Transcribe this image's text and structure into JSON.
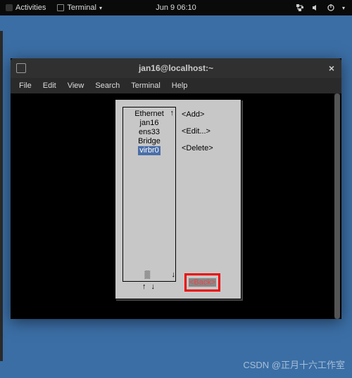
{
  "topbar": {
    "activities": "Activities",
    "terminal": "Terminal",
    "datetime": "Jun 9  06:10"
  },
  "window": {
    "title": "jan16@localhost:~",
    "close": "×"
  },
  "menubar": {
    "file": "File",
    "edit": "Edit",
    "view": "View",
    "search": "Search",
    "terminal": "Terminal",
    "help": "Help"
  },
  "tui": {
    "list": {
      "group1": "Ethernet",
      "item1": "jan16",
      "item2": "ens33",
      "group2": "Bridge",
      "item3": "virbr0",
      "arrows": "↑  ↓"
    },
    "actions": {
      "add": "<Add>",
      "edit": "<Edit...>",
      "del": "<Delete>",
      "back": "<Back>"
    }
  },
  "watermark": "CSDN @正月十六工作室"
}
